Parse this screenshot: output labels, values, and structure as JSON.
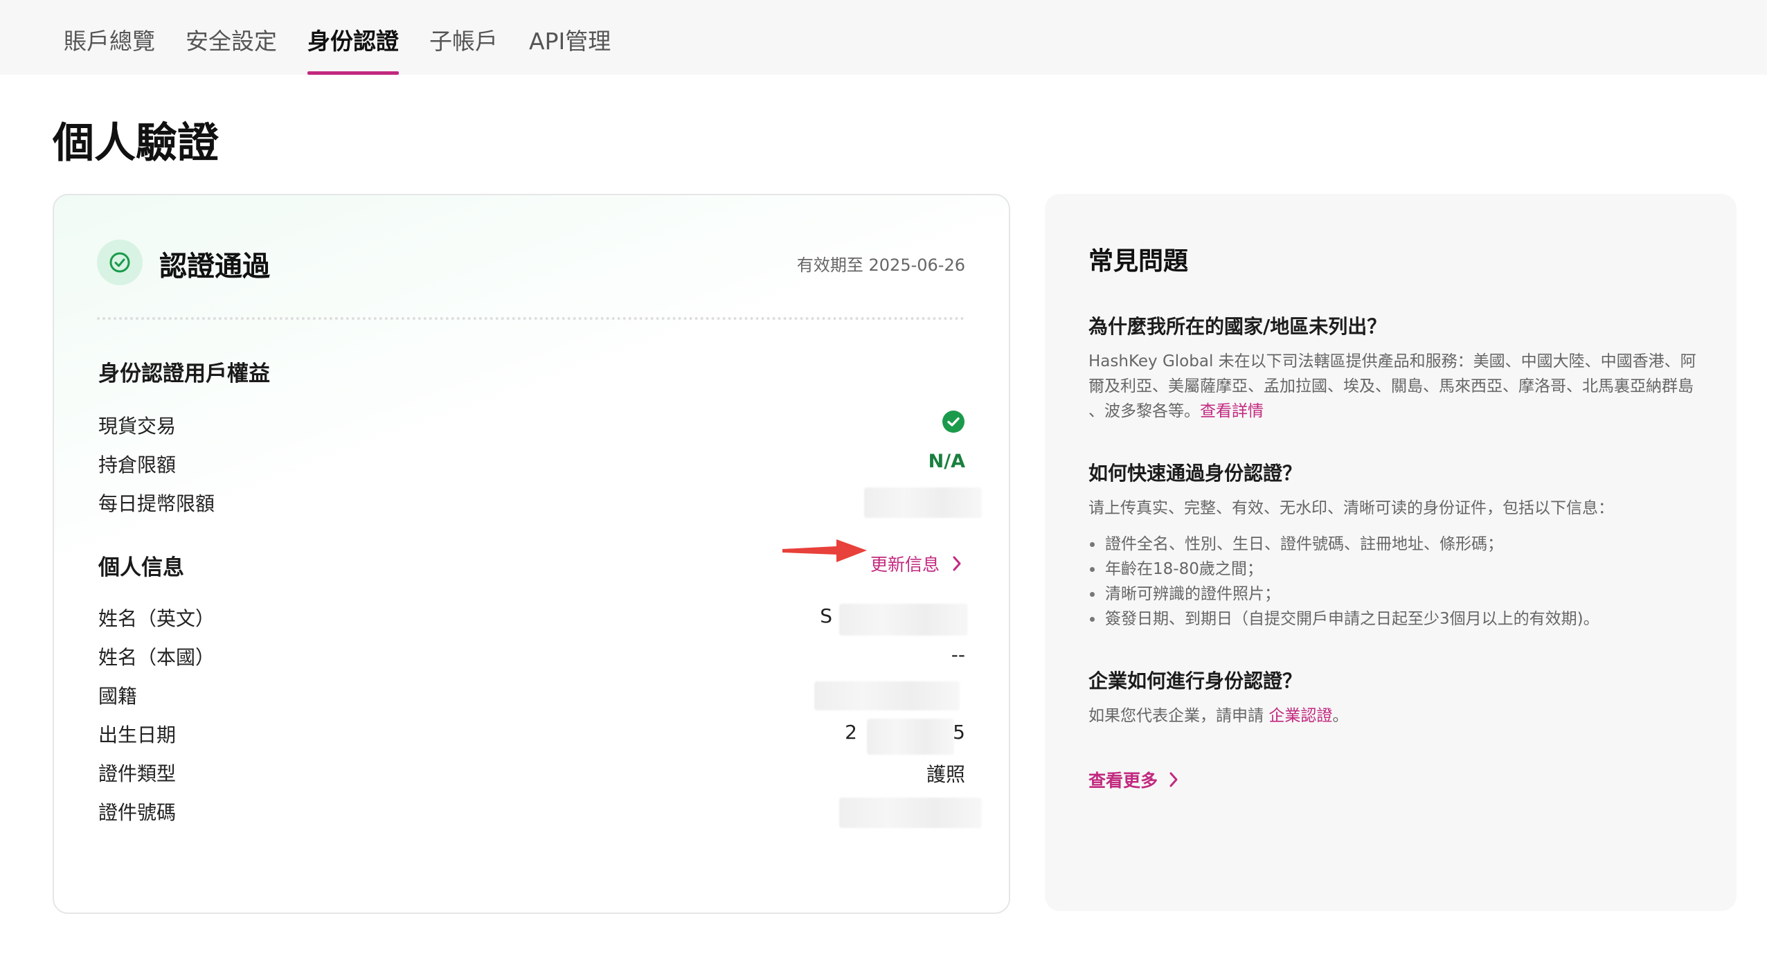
{
  "tabs": [
    {
      "label": "賬戶總覽"
    },
    {
      "label": "安全設定"
    },
    {
      "label": "身份認證"
    },
    {
      "label": "子帳戶"
    },
    {
      "label": "API管理"
    }
  ],
  "page_title": "個人驗證",
  "verification": {
    "status": "認證通過",
    "valid_until": "有效期至 2025-06-26",
    "status_color": "#1b9a4b"
  },
  "benefits": {
    "title": "身份認證用戶權益",
    "rows": [
      {
        "label": "現貨交易",
        "value_icon": "check-circle-icon"
      },
      {
        "label": "持倉限額",
        "value": "N/A"
      },
      {
        "label": "每日提幣限額",
        "value": ""
      }
    ]
  },
  "personal": {
    "title": "個人信息",
    "update_link": "更新信息",
    "rows": [
      {
        "label": "姓名（英文）",
        "value": "S"
      },
      {
        "label": "姓名（本國）",
        "value": "--"
      },
      {
        "label": "國籍",
        "value": ""
      },
      {
        "label": "出生日期",
        "value_start": "2",
        "value_end": "5"
      },
      {
        "label": "證件類型",
        "value": "護照"
      },
      {
        "label": "證件號碼",
        "value": ""
      }
    ]
  },
  "faq": {
    "title": "常見問題",
    "q1": "為什麼我所在的國家/地區未列出？",
    "a1": "HashKey Global 未在以下司法轄區提供產品和服務：美國、中國大陸、中國香港、阿爾及利亞、美屬薩摩亞、孟加拉國、埃及、關島、馬來西亞、摩洛哥、北馬裏亞納群島 、波多黎各等。",
    "a1_link": "查看詳情",
    "q2": "如何快速通過身份認證？",
    "a2": "请上传真实、完整、有效、无水印、清晰可读的身份证件，包括以下信息：",
    "a2_bullets": [
      "證件全名、性別、生日、證件號碼、註冊地址、條形碼；",
      "年齡在18-80歲之間；",
      "清晰可辨識的證件照片；",
      "簽發日期、到期日（自提交開戶申請之日起至少3個月以上的有效期)。"
    ],
    "q3": "企業如何進行身份認證？",
    "a3": "如果您代表企業，請申請 ",
    "a3_link": "企業認證",
    "a3_end": "。",
    "more_link": "查看更多"
  },
  "colors": {
    "accent": "#c2297f",
    "success": "#1b9a4b",
    "annotation_arrow": "#e8403a"
  }
}
